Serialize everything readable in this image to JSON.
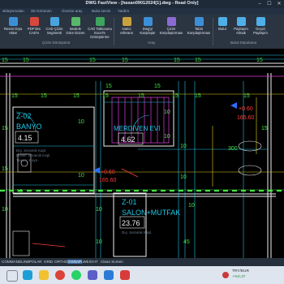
{
  "window": {
    "title": "DWG FastView - [hasan09012024[1].dwg - Read Only]",
    "minimize": "–",
    "maximize": "☐",
    "close": "✕"
  },
  "tabs": [
    "aklaştırmaları",
    "3D Görünüm",
    "Üzerine araç",
    "Bulut servis",
    "Yardım"
  ],
  "ribbon": {
    "buttons": [
      {
        "label": "Resmi Dışa Aktar",
        "color": "#3c8fd6"
      },
      {
        "label": "PDF'den CAD'e",
        "color": "#d8473c"
      },
      {
        "label": "CAD Çizim Segmenti",
        "color": "#4aa3df"
      },
      {
        "label": "Modele Göre Düzen",
        "color": "#58b86a"
      },
      {
        "label": "CAD Tablosunu Excel'e Dönüştürme",
        "color": "#3da55d"
      },
      {
        "label": "Harici referans",
        "color": "#c9a23d"
      },
      {
        "label": "Dwg'yi Karşılaştır",
        "color": "#3c8fd6"
      },
      {
        "label": "Çizim Karşılaştırması",
        "color": "#8a6bd1"
      },
      {
        "label": "Tablo Karşılaştırması",
        "color": "#3c8fd6"
      },
      {
        "label": "Bulut",
        "color": "#4fb0e8"
      },
      {
        "label": "Paylaşım Almak",
        "color": "#4fb0e8"
      },
      {
        "label": "Geçici Paylaşım",
        "color": "#4fb0e8"
      }
    ],
    "groups": [
      "Çizim Dönüşümü",
      "Araç",
      "Bulut Depolama"
    ]
  },
  "drawing": {
    "rooms": [
      {
        "code": "Z-02",
        "name": "BANYO",
        "area": "4.15",
        "notes": [
          "Dış. Seramik Kapl.",
          "Duvar: Seramik Kapl.",
          "Tavan : Boya"
        ]
      },
      {
        "code": "",
        "name": "MERDİVEN EVİ",
        "area": "4.62",
        "notes": []
      },
      {
        "code": "Z-01",
        "name": "SALON+MUTFAK",
        "area": "23.76",
        "notes": [
          "Dış. Seramik Kapl."
        ]
      }
    ],
    "level_marks": [
      {
        "top": "+0.60",
        "bottom": "165.60"
      },
      {
        "top": "+0.60",
        "bottom": "165.60"
      }
    ],
    "dimensions": [
      "15",
      "15",
      "15",
      "15",
      "15",
      "15",
      "15",
      "15",
      "15",
      "15",
      "15",
      "15",
      "15",
      "15",
      "15",
      "15",
      "15",
      "15",
      "10",
      "10",
      "10",
      "10",
      "10",
      "10",
      "10",
      "10",
      "10",
      "10",
      "10",
      "300",
      "45",
      "15",
      "15"
    ]
  },
  "statusbar": {
    "items": [
      "COMMANDLINE",
      "POLAR",
      "GRID",
      "ORTHO",
      "OSNAP",
      "LWEIGHT",
      "Clean Screen"
    ]
  },
  "taskbar": {
    "currency": "TRY/EUR",
    "change": "+%0,37",
    "apps": [
      {
        "name": "search-app",
        "color": "#ffffff"
      },
      {
        "name": "edge-app",
        "color": "#1c9fd6"
      },
      {
        "name": "explorer-app",
        "color": "#f2c12e"
      },
      {
        "name": "chrome-app",
        "color": "#db4437"
      },
      {
        "name": "whatsapp-app",
        "color": "#25d366"
      },
      {
        "name": "teams-app",
        "color": "#5b5fc7"
      },
      {
        "name": "photos-app",
        "color": "#2b7bd6"
      },
      {
        "name": "cad-app",
        "color": "#d83b3b"
      }
    ]
  }
}
